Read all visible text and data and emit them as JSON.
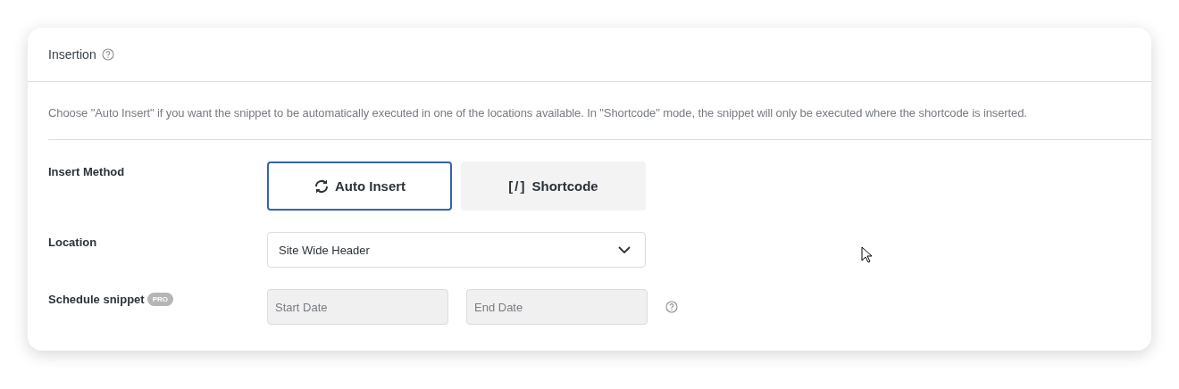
{
  "panel": {
    "title": "Insertion",
    "description": "Choose \"Auto Insert\" if you want the snippet to be automatically executed in one of the locations available. In \"Shortcode\" mode, the snippet will only be executed where the shortcode is inserted."
  },
  "insert_method": {
    "label": "Insert Method",
    "options": [
      {
        "kind": "auto",
        "label": "Auto Insert",
        "selected": true
      },
      {
        "kind": "shortcode",
        "icon_text": "[/]",
        "label": "Shortcode",
        "selected": false
      }
    ]
  },
  "location": {
    "label": "Location",
    "value": "Site Wide Header"
  },
  "schedule": {
    "label": "Schedule snippet",
    "badge": "PRO",
    "start": {
      "placeholder": "Start Date",
      "disabled": true
    },
    "end": {
      "placeholder": "End Date",
      "disabled": true
    }
  }
}
